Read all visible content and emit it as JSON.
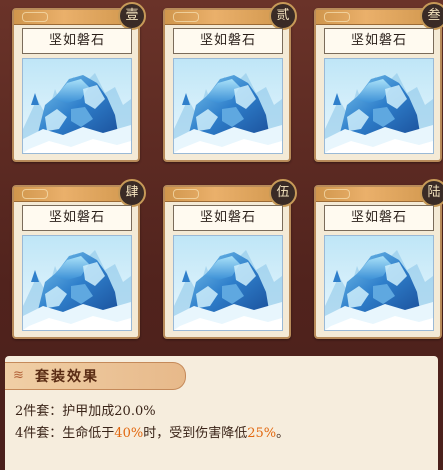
{
  "cards": [
    {
      "badge": "壹",
      "name": "坚如磐石"
    },
    {
      "badge": "贰",
      "name": "坚如磐石"
    },
    {
      "badge": "叁",
      "name": "坚如磐石"
    },
    {
      "badge": "肆",
      "name": "坚如磐石"
    },
    {
      "badge": "伍",
      "name": "坚如磐石"
    },
    {
      "badge": "陆",
      "name": "坚如磐石"
    }
  ],
  "set_effect": {
    "title": "套装效果",
    "line1": {
      "label": "2件套：",
      "text": "护甲加成20.0%"
    },
    "line2": {
      "label": "4件套：",
      "pre": "生命低于",
      "hl1": "40%",
      "mid": "时，受到伤害降低",
      "hl2": "25%",
      "post": "。"
    }
  },
  "colors": {
    "accent": "#e2680f",
    "card_border": "#b88b5a",
    "badge_bg": "#3a2b26"
  }
}
